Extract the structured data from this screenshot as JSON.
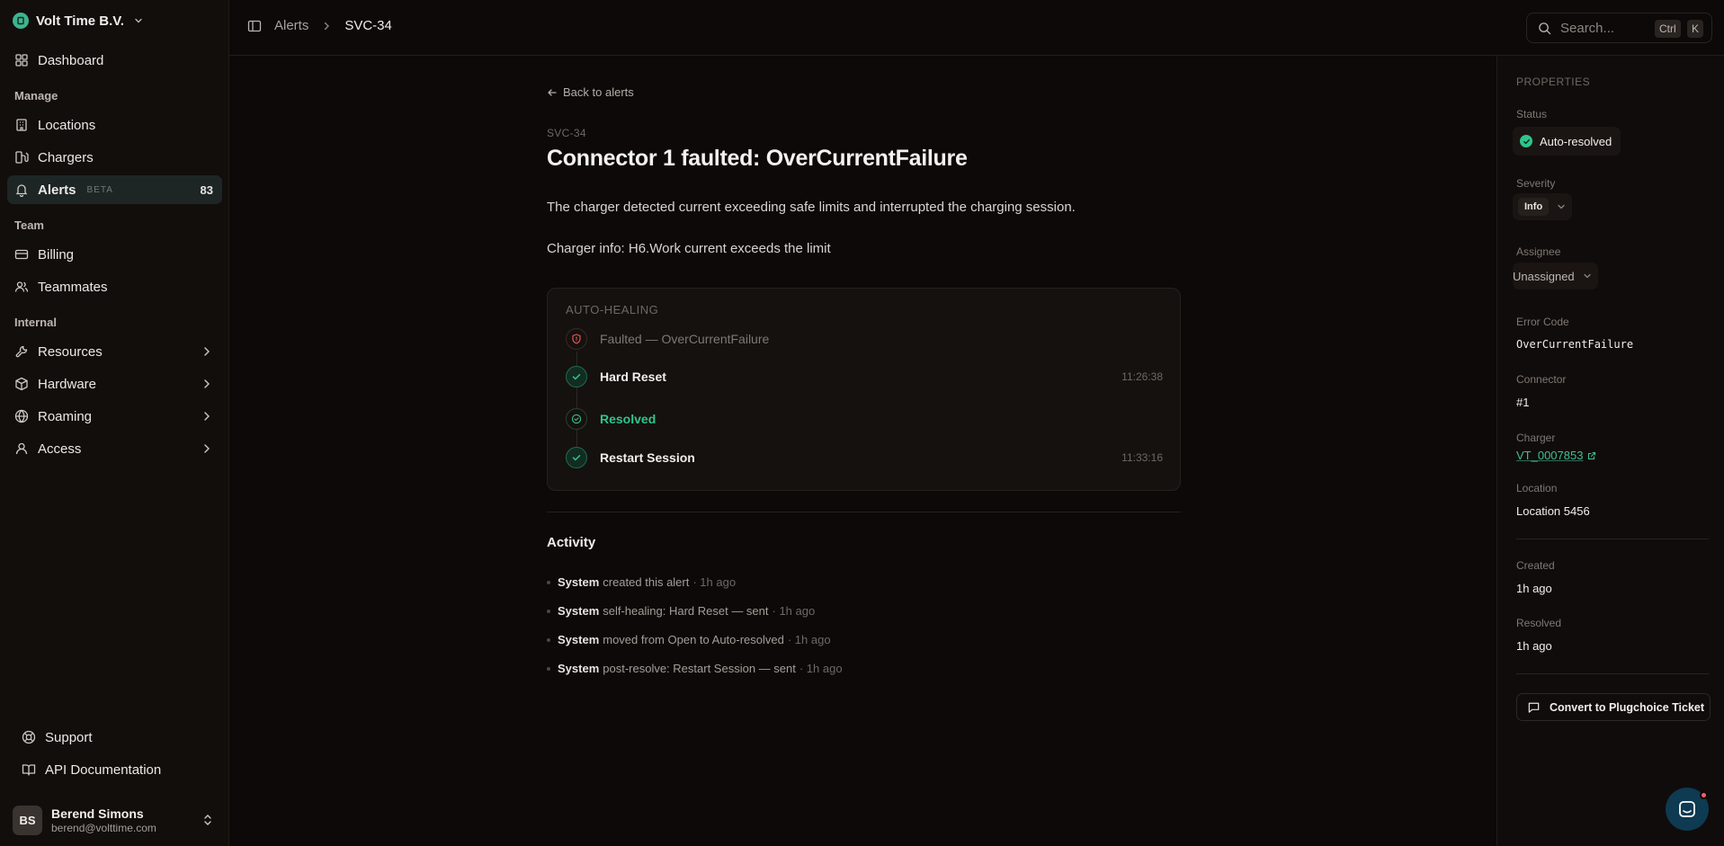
{
  "sidebar": {
    "org_name": "Volt Time B.V.",
    "dashboard": "Dashboard",
    "manage_label": "Manage",
    "locations": "Locations",
    "chargers": "Chargers",
    "alerts": "Alerts",
    "alerts_badge": "BETA",
    "alerts_count": "83",
    "team_label": "Team",
    "billing": "Billing",
    "teammates": "Teammates",
    "internal_label": "Internal",
    "resources": "Resources",
    "hardware": "Hardware",
    "roaming": "Roaming",
    "access": "Access",
    "support": "Support",
    "api_docs": "API Documentation",
    "user": {
      "initials": "BS",
      "name": "Berend Simons",
      "email": "berend@volttime.com"
    }
  },
  "topbar": {
    "breadcrumb_parent": "Alerts",
    "breadcrumb_current": "SVC-34",
    "search_placeholder": "Search...",
    "kbd_ctrl": "Ctrl",
    "kbd_k": "K"
  },
  "alert": {
    "back_label": "Back to alerts",
    "id": "SVC-34",
    "title": "Connector 1 faulted: OverCurrentFailure",
    "description": "The charger detected current exceeding safe limits and interrupted the charging session.",
    "charger_info": "Charger info: H6.Work current exceeds the limit"
  },
  "auto_healing": {
    "label": "AUTO-HEALING",
    "steps": [
      {
        "label": "Faulted — OverCurrentFailure",
        "time": ""
      },
      {
        "label": "Hard Reset",
        "time": "11:26:38"
      },
      {
        "label": "Resolved",
        "time": ""
      },
      {
        "label": "Restart Session",
        "time": "11:33:16"
      }
    ]
  },
  "activity": {
    "title": "Activity",
    "items": [
      {
        "actor": "System",
        "text": "created this alert",
        "time": "· 1h ago"
      },
      {
        "actor": "System",
        "text": "self-healing: Hard Reset — sent",
        "time": "· 1h ago"
      },
      {
        "actor": "System",
        "text": "moved from Open to Auto-resolved",
        "time": "· 1h ago"
      },
      {
        "actor": "System",
        "text": "post-resolve: Restart Session — sent",
        "time": "· 1h ago"
      }
    ]
  },
  "properties": {
    "heading": "PROPERTIES",
    "status_label": "Status",
    "status_value": "Auto-resolved",
    "severity_label": "Severity",
    "severity_value": "Info",
    "assignee_label": "Assignee",
    "assignee_value": "Unassigned",
    "error_code_label": "Error Code",
    "error_code_value": "OverCurrentFailure",
    "connector_label": "Connector",
    "connector_value": "#1",
    "charger_label": "Charger",
    "charger_value": "VT_0007853",
    "location_label": "Location",
    "location_value": "Location 5456",
    "created_label": "Created",
    "created_value": "1h ago",
    "resolved_label": "Resolved",
    "resolved_value": "1h ago",
    "convert_button": "Convert to Plugchoice Ticket"
  },
  "colors": {
    "accent_green": "#2fc58a",
    "link_teal": "#3fbf98",
    "background": "#0c0908",
    "chat_button": "#0e3a52",
    "notification_dot": "#ff5b64"
  }
}
